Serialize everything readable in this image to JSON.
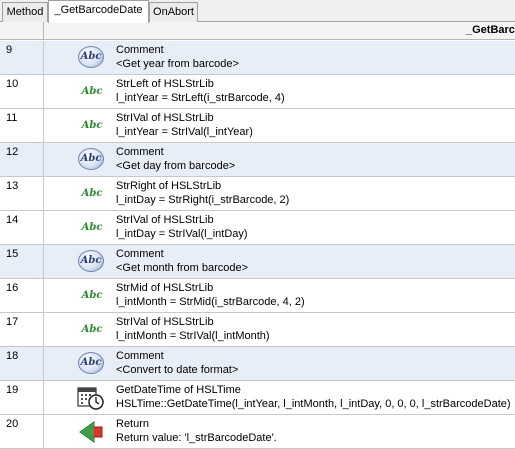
{
  "tabs": [
    {
      "label": "Method"
    },
    {
      "label": "_GetBarcodeDate"
    },
    {
      "label": "OnAbort"
    }
  ],
  "header": {
    "title": "_GetBarco"
  },
  "icon_text": "Abc",
  "steps": [
    {
      "num": "9",
      "icon": "comment-abc-icon",
      "line1": "Comment",
      "line2": "<Get year from barcode>"
    },
    {
      "num": "10",
      "icon": "string-abc-icon",
      "line1": "StrLeft of HSLStrLib",
      "line2": "l_intYear = StrLeft(i_strBarcode, 4)"
    },
    {
      "num": "11",
      "icon": "string-abc-icon",
      "line1": "StrIVal of HSLStrLib",
      "line2": "l_intYear = StrIVal(l_intYear)"
    },
    {
      "num": "12",
      "icon": "comment-abc-icon",
      "line1": "Comment",
      "line2": "<Get day from barcode>"
    },
    {
      "num": "13",
      "icon": "string-abc-icon",
      "line1": "StrRight of HSLStrLib",
      "line2": "l_intDay = StrRight(i_strBarcode, 2)"
    },
    {
      "num": "14",
      "icon": "string-abc-icon",
      "line1": "StrIVal of HSLStrLib",
      "line2": "l_intDay = StrIVal(l_intDay)"
    },
    {
      "num": "15",
      "icon": "comment-abc-icon",
      "line1": "Comment",
      "line2": "<Get month from barcode>"
    },
    {
      "num": "16",
      "icon": "string-abc-icon",
      "line1": "StrMid of HSLStrLib",
      "line2": "l_intMonth = StrMid(i_strBarcode, 4, 2)"
    },
    {
      "num": "17",
      "icon": "string-abc-icon",
      "line1": "StrIVal of HSLStrLib",
      "line2": "l_intMonth = StrIVal(l_intMonth)"
    },
    {
      "num": "18",
      "icon": "comment-abc-icon",
      "line1": "Comment",
      "line2": "<Convert to date format>"
    },
    {
      "num": "19",
      "icon": "calendar-clock-icon",
      "line1": "GetDateTime of HSLTime",
      "line2": "HSLTime::GetDateTime(l_intYear, l_intMonth, l_intDay, 0, 0, 0, l_strBarcodeDate)"
    },
    {
      "num": "20",
      "icon": "return-arrow-icon",
      "line1": "Return",
      "line2": "Return value: 'l_strBarcodeDate'."
    }
  ]
}
